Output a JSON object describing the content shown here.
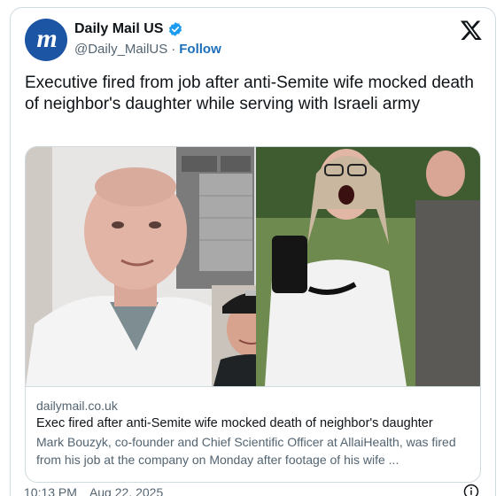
{
  "account": {
    "name": "Daily Mail US",
    "handle": "@Daily_MailUS",
    "separator": "·",
    "follow_label": "Follow",
    "avatar_letter": "m"
  },
  "tweet": {
    "text": "Executive fired from job after anti-Semite wife mocked death of neighbor's daughter while serving with Israeli army"
  },
  "link_card": {
    "domain": "dailymail.co.uk",
    "title": "Exec fired after anti-Semite wife mocked death of neighbor's daughter",
    "description": "Mark Bouzyk, co-founder and Chief Scientific Officer at AllaiHealth, was fired from his job at the company on Monday after footage of his wife ..."
  },
  "footer": {
    "time": "10:13 PM",
    "date": "Aug 22, 2025"
  },
  "colors": {
    "brand_blue": "#1c55a3",
    "verified_blue": "#1d9bf0",
    "follow_blue": "#1d6fb8"
  },
  "icons": [
    "verified-badge-icon",
    "x-logo-icon",
    "info-icon"
  ]
}
